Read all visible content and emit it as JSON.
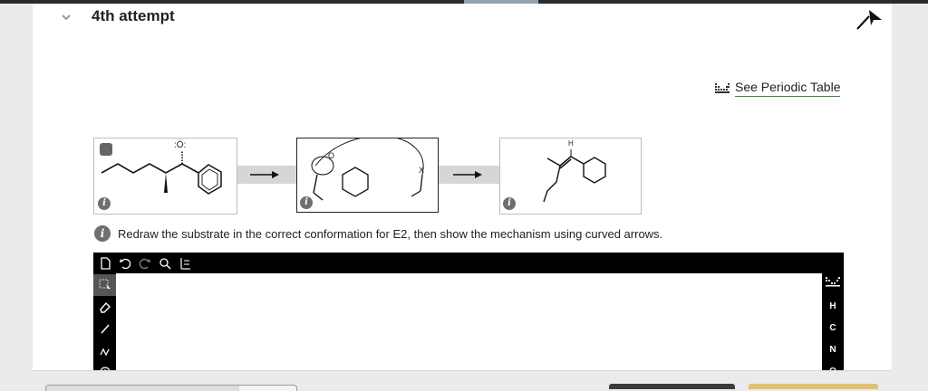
{
  "header": {
    "title": "4th attempt"
  },
  "periodic_table": {
    "label": "See Periodic Table"
  },
  "instructions": {
    "text": "Redraw the substrate in the correct conformation for E2, then show the mechanism using curved arrows."
  },
  "molecules": {
    "reactant": {
      "oxygen_label": ":Ö:"
    },
    "transition": {
      "base_label": "O",
      "leaving_label": "X"
    },
    "product": {
      "h_label": "H"
    }
  },
  "editor": {
    "right_elements": [
      "H",
      "C",
      "N",
      "O"
    ]
  },
  "colors": {
    "accent_underline": "#3d8a3d",
    "submit_button": "#e2c070",
    "toolbar_bg": "#000000"
  }
}
